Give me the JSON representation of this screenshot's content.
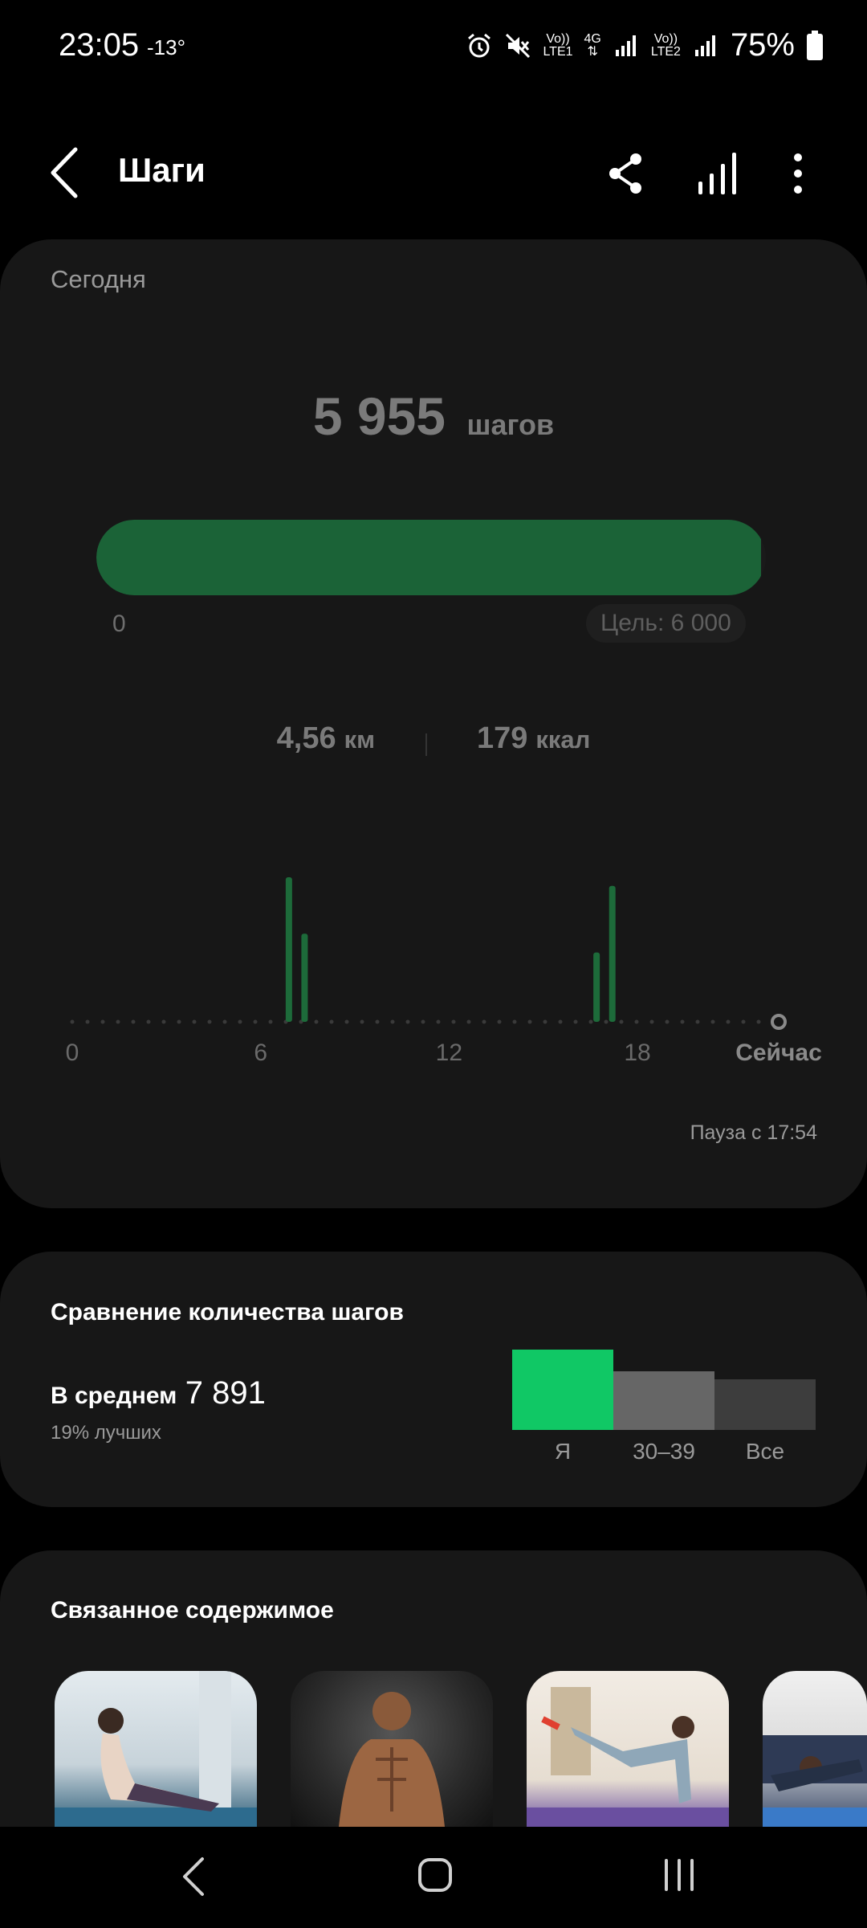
{
  "status_bar": {
    "time": "23:05",
    "temp": "-13°",
    "sim1_label_top": "Vo))",
    "sim1_label_bottom": "LTE1",
    "net_label": "4G",
    "sim2_label_top": "Vo))",
    "sim2_label_bottom": "LTE2",
    "battery_percent": "75%",
    "icons": [
      "alarm-icon",
      "mute-icon",
      "signal-icon",
      "battery-icon"
    ]
  },
  "app_bar": {
    "title": "Шаги",
    "icons": [
      "back-arrow-icon",
      "share-icon",
      "bar-chart-icon",
      "more-vert-icon"
    ]
  },
  "today": {
    "label": "Сегодня",
    "steps_value": "5 955",
    "steps_unit": "шагов",
    "progress_fraction": 0.9925,
    "progress_start": "0",
    "goal_label": "Цель: 6 000",
    "distance_value": "4,56",
    "distance_unit": "км",
    "calories_value": "179",
    "calories_unit": "ккал",
    "chart_x_labels": [
      "0",
      "6",
      "12",
      "18",
      "Сейчас"
    ],
    "pause_text": "Пауза с 17:54",
    "colors": {
      "accent": "#1b6337",
      "bar": "#1d6b3a"
    }
  },
  "chart_data": {
    "type": "bar",
    "x": [
      6.9,
      7.4,
      16.7,
      17.2
    ],
    "values": [
      1.0,
      0.61,
      0.48,
      0.94
    ],
    "xlim": [
      0,
      22.5
    ],
    "xticks": [
      "0",
      "6",
      "12",
      "18",
      "Сейчас"
    ],
    "grid": false
  },
  "compare": {
    "title": "Сравнение количества шагов",
    "avg_label": "В среднем",
    "avg_value": "7 891",
    "better_text": "19% лучших",
    "bars": [
      {
        "label": "Я",
        "level": 1.0,
        "color": "#10c865"
      },
      {
        "label": "30–39",
        "level": 0.73,
        "color": "#666666"
      },
      {
        "label": "Все",
        "level": 0.63,
        "color": "#3d3d3d"
      }
    ]
  },
  "related": {
    "title": "Связанное содержимое",
    "items": [
      "yoga-stretch-image",
      "muscular-man-image",
      "leg-exercise-image",
      "plank-exercise-image"
    ]
  },
  "nav_bar": {
    "icons": [
      "nav-back-icon",
      "nav-home-icon",
      "nav-recent-icon"
    ]
  }
}
